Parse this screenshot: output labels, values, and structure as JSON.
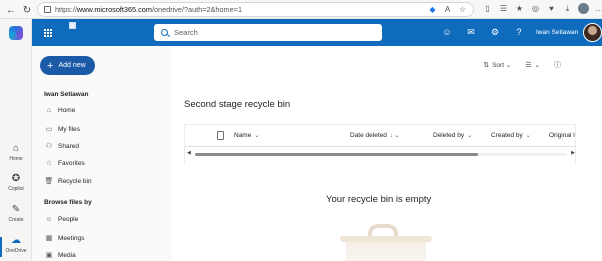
{
  "browser": {
    "url_prefix": "https://",
    "url_host": "www.microsoft365.com",
    "url_path": "/onedrive/?auth=2&home=1"
  },
  "rail": {
    "items": [
      {
        "label": "Home",
        "icon": "home-icon"
      },
      {
        "label": "Copilot",
        "icon": "copilot-icon"
      },
      {
        "label": "Create",
        "icon": "create-icon"
      },
      {
        "label": "OneDrive",
        "icon": "onedrive-icon"
      }
    ]
  },
  "suite": {
    "search_placeholder": "Search",
    "user_name": "Iwan Setiawan"
  },
  "leftnav": {
    "add_new": "Add new",
    "user": "Iwan Setiawan",
    "items": [
      {
        "label": "Home"
      },
      {
        "label": "My files"
      },
      {
        "label": "Shared"
      },
      {
        "label": "Favorites"
      },
      {
        "label": "Recycle bin"
      }
    ],
    "section_label": "Browse files by",
    "browse_items": [
      {
        "label": "People"
      },
      {
        "label": "Meetings"
      },
      {
        "label": "Media"
      }
    ]
  },
  "commandbar": {
    "sort_label": "Sort"
  },
  "main": {
    "page_title": "Second stage recycle bin",
    "columns": [
      {
        "label": "Name",
        "indicator": "⌄"
      },
      {
        "label": "Date deleted",
        "indicator": "↓ ⌄"
      },
      {
        "label": "Deleted by",
        "indicator": "⌄"
      },
      {
        "label": "Created by",
        "indicator": "⌄"
      },
      {
        "label": "Original l",
        "indicator": ""
      }
    ],
    "empty_message": "Your recycle bin is empty"
  },
  "colors": {
    "suite_blue": "#0f6cbd",
    "add_new_blue": "#1b5aa6"
  }
}
